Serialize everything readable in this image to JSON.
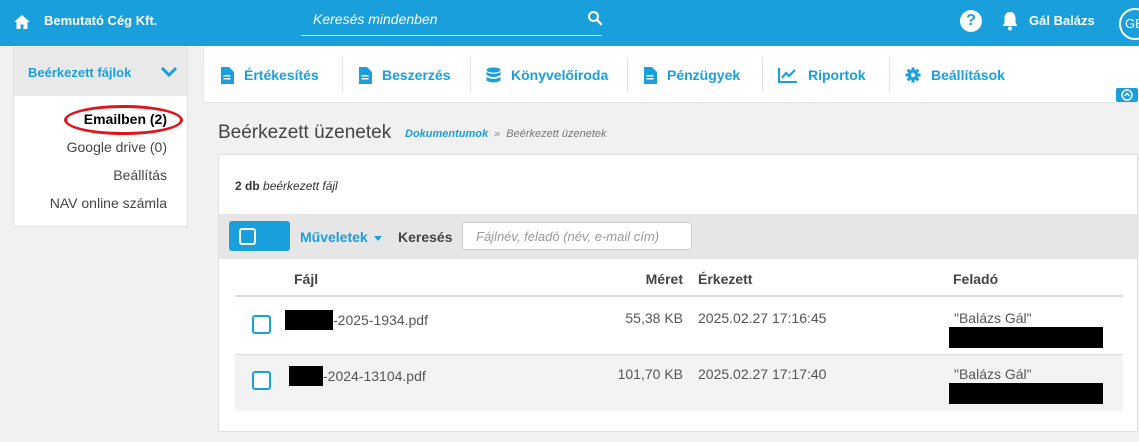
{
  "header": {
    "company": "Bemutató Cég Kft.",
    "search_placeholder": "Keresés mindenben",
    "help": "?",
    "user": "Gál Balázs",
    "avatar": "GB"
  },
  "sidebar": {
    "title": "Beérkezett fájlok",
    "items": [
      {
        "label": "Emailben (2)"
      },
      {
        "label": "Google drive (0)"
      },
      {
        "label": "Beállítás"
      },
      {
        "label": "NAV online számla"
      }
    ]
  },
  "nav": {
    "items": [
      {
        "label": "Értékesítés",
        "icon": "document-icon"
      },
      {
        "label": "Beszerzés",
        "icon": "document-icon"
      },
      {
        "label": "Könyvelőiroda",
        "icon": "database-icon"
      },
      {
        "label": "Pénzügyek",
        "icon": "document-icon"
      },
      {
        "label": "Riportok",
        "icon": "line-chart-icon"
      },
      {
        "label": "Beállítások",
        "icon": "gear-icon"
      }
    ]
  },
  "page": {
    "title": "Beérkezett üzenetek",
    "breadcrumb": {
      "link": "Dokumentumok",
      "sep": "»",
      "current": "Beérkezett üzenetek"
    }
  },
  "content": {
    "count_number": "2 db",
    "count_text": "beérkezett fájl",
    "toolbar": {
      "actions": "Műveletek",
      "search_label": "Keresés",
      "search_placeholder": "Fájlnév, feladó (név, e-mail cím)"
    },
    "columns": {
      "file": "Fájl",
      "size": "Méret",
      "arrived": "Érkezett",
      "sender": "Feladó"
    },
    "rows": [
      {
        "file": "-2025-1934.pdf",
        "size": "55,38 KB",
        "arrived": "2025.02.27 17:16:45",
        "sender": "\"Balázs Gál\""
      },
      {
        "file": "-2024-13104.pdf",
        "size": "101,70 KB",
        "arrived": "2025.02.27 17:17:40",
        "sender": "\"Balázs Gál\""
      }
    ]
  },
  "colors": {
    "accent": "#1a9fdd",
    "highlight": "#e0141b"
  }
}
